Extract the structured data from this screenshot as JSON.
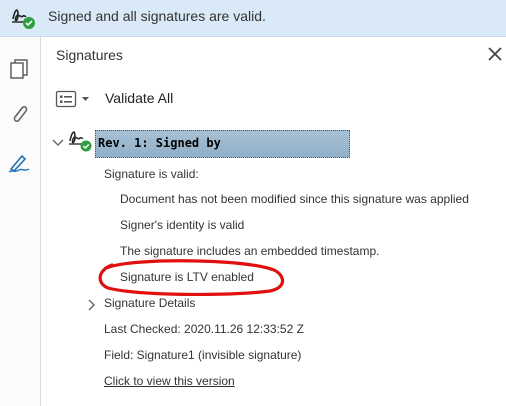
{
  "banner": {
    "text": "Signed and all signatures are valid."
  },
  "panel": {
    "title": "Signatures",
    "validate_all": "Validate All"
  },
  "signature": {
    "header": "Rev. 1: Signed by",
    "valid_label": "Signature is valid:",
    "checks": [
      "Document has not been modified since this signature was applied",
      "Signer's identity is valid",
      "The signature includes an embedded timestamp.",
      "Signature is LTV enabled"
    ],
    "details_label": "Signature Details",
    "last_checked": "Last Checked: 2020.11.26 12:33:52 Z",
    "field": "Field: Signature1 (invisible signature)",
    "view_link": "Click to view this version"
  },
  "icons": {
    "banner": "signature-valid-icon",
    "pages": "pages-icon",
    "attachments": "paperclip-icon",
    "signatures": "signature-pen-icon",
    "close": "close-icon",
    "options": "options-menu-icon",
    "tree": "chevron-down-icon",
    "details": "chevron-right-icon"
  },
  "colors": {
    "banner_bg": "#d9e9f7",
    "valid_green": "#2e9e3f",
    "header_bg": "#9cb7cd",
    "annotation_red": "#e01010",
    "icon_blue": "#1f6fb2"
  }
}
